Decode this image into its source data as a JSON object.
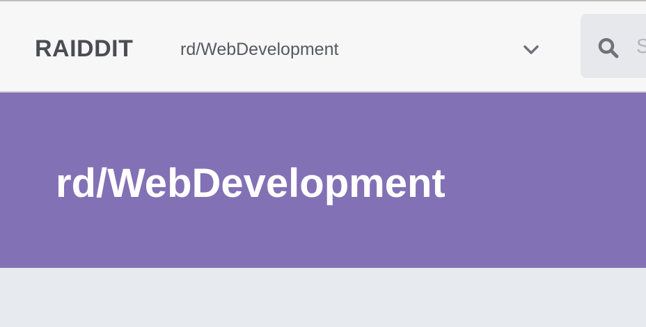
{
  "header": {
    "logo": "RAIDDIT",
    "community_selector": {
      "selected": "rd/WebDevelopment",
      "icon": "chevron-down-icon"
    },
    "search": {
      "icon": "search-icon",
      "placeholder": "S"
    }
  },
  "banner": {
    "title": "rd/WebDevelopment",
    "color": "#8371b6"
  },
  "colors": {
    "topbar_bg": "#f7f7f7",
    "page_bg": "#e7eaee",
    "logo_text": "#4a4d52"
  }
}
